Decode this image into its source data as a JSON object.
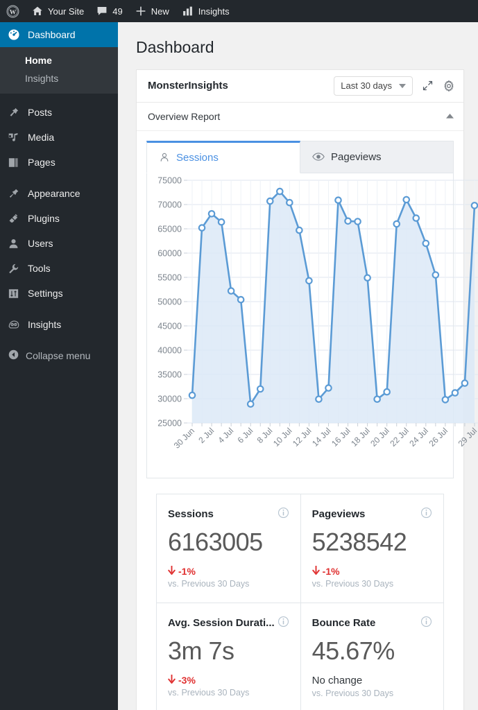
{
  "adminbar": {
    "items": [
      {
        "icon": "wordpress-logo-icon",
        "label": ""
      },
      {
        "icon": "home-icon",
        "label": "Your Site"
      },
      {
        "icon": "comment-bubble-icon",
        "label": "49"
      },
      {
        "icon": "plus-icon",
        "label": "New"
      },
      {
        "icon": "bar-chart-icon",
        "label": "Insights"
      }
    ]
  },
  "sidebar": {
    "dashboard": {
      "label": "Dashboard",
      "icon": "dashboard-gauge-icon"
    },
    "submenu": [
      {
        "label": "Home",
        "current": true
      },
      {
        "label": "Insights",
        "current": false
      }
    ],
    "items": [
      {
        "label": "Posts",
        "icon": "pushpin-icon"
      },
      {
        "label": "Media",
        "icon": "media-music-icon"
      },
      {
        "label": "Pages",
        "icon": "pages-icon"
      },
      {
        "label": "Appearance",
        "icon": "paintbrush-icon"
      },
      {
        "label": "Plugins",
        "icon": "plug-icon"
      },
      {
        "label": "Users",
        "icon": "user-icon"
      },
      {
        "label": "Tools",
        "icon": "wrench-icon"
      },
      {
        "label": "Settings",
        "icon": "settings-sliders-icon"
      },
      {
        "label": "Insights",
        "icon": "monsterinsights-icon"
      }
    ],
    "collapse": {
      "label": "Collapse menu",
      "icon": "collapse-arrow-icon"
    }
  },
  "page": {
    "title": "Dashboard"
  },
  "widget": {
    "title": "MonsterInsights",
    "date_range": "Last 30 days",
    "expand_icon": "expand-arrows-icon",
    "settings_icon": "gear-icon",
    "report_label": "Overview Report",
    "collapse_icon": "caret-up-icon"
  },
  "tabs": [
    {
      "label": "Sessions",
      "icon": "user-outline-icon",
      "active": true
    },
    {
      "label": "Pageviews",
      "icon": "eye-icon",
      "active": false
    }
  ],
  "cards": [
    {
      "title": "Sessions",
      "value": "6163005",
      "delta": "-1%",
      "delta_dir": "down",
      "delta_icon": "arrow-down-icon",
      "sub": "vs. Previous 30 Days",
      "info_icon": "info-circle-icon"
    },
    {
      "title": "Pageviews",
      "value": "5238542",
      "delta": "-1%",
      "delta_dir": "down",
      "delta_icon": "arrow-down-icon",
      "sub": "vs. Previous 30 Days",
      "info_icon": "info-circle-icon"
    },
    {
      "title": "Avg. Session Durati...",
      "value": "3m 7s",
      "delta": "-3%",
      "delta_dir": "down",
      "delta_icon": "arrow-down-icon",
      "sub": "vs. Previous 30 Days",
      "info_icon": "info-circle-icon"
    },
    {
      "title": "Bounce Rate",
      "value": "45.67%",
      "delta": "No change",
      "delta_dir": "flat",
      "delta_icon": "",
      "sub": "vs. Previous 30 Days",
      "info_icon": "info-circle-icon"
    }
  ],
  "colors": {
    "accent": "#0073aa",
    "line": "#5b9bd5",
    "area": "#dce9f7",
    "negative": "#e03030",
    "admin_bg": "#23282d",
    "submenu_bg": "#32373c"
  },
  "chart_data": {
    "type": "area",
    "title": "",
    "xlabel": "",
    "ylabel": "",
    "ylim": [
      25000,
      75000
    ],
    "ytick_step": 5000,
    "yticks": [
      25000,
      30000,
      35000,
      40000,
      45000,
      50000,
      55000,
      60000,
      65000,
      70000,
      75000
    ],
    "grid": true,
    "legend": "none",
    "x": [
      "30 Jun",
      "1 Jul",
      "2 Jul",
      "3 Jul",
      "4 Jul",
      "5 Jul",
      "6 Jul",
      "7 Jul",
      "8 Jul",
      "9 Jul",
      "10 Jul",
      "11 Jul",
      "12 Jul",
      "13 Jul",
      "14 Jul",
      "15 Jul",
      "16 Jul",
      "17 Jul",
      "18 Jul",
      "19 Jul",
      "20 Jul",
      "21 Jul",
      "22 Jul",
      "23 Jul",
      "24 Jul",
      "25 Jul",
      "26 Jul",
      "27 Jul",
      "28 Jul",
      "29 Jul"
    ],
    "xtick_labels": [
      "30 Jun",
      "",
      "2 Jul",
      "",
      "4 Jul",
      "",
      "6 Jul",
      "",
      "8 Jul",
      "",
      "10 Jul",
      "",
      "12 Jul",
      "",
      "14 Jul",
      "",
      "16 Jul",
      "",
      "18 Jul",
      "",
      "20 Jul",
      "",
      "22 Jul",
      "",
      "24 Jul",
      "",
      "26 Jul",
      "",
      "",
      "29 Jul"
    ],
    "series": [
      {
        "name": "Sessions",
        "values": [
          30700,
          65200,
          68100,
          66400,
          52200,
          50400,
          28900,
          32000,
          70700,
          72700,
          70400,
          64700,
          54300,
          29900,
          32200,
          70900,
          66600,
          66500,
          54900,
          29900,
          31400,
          66000,
          71000,
          67200,
          62000,
          55500,
          29800,
          31200,
          33200,
          69800
        ]
      }
    ]
  }
}
